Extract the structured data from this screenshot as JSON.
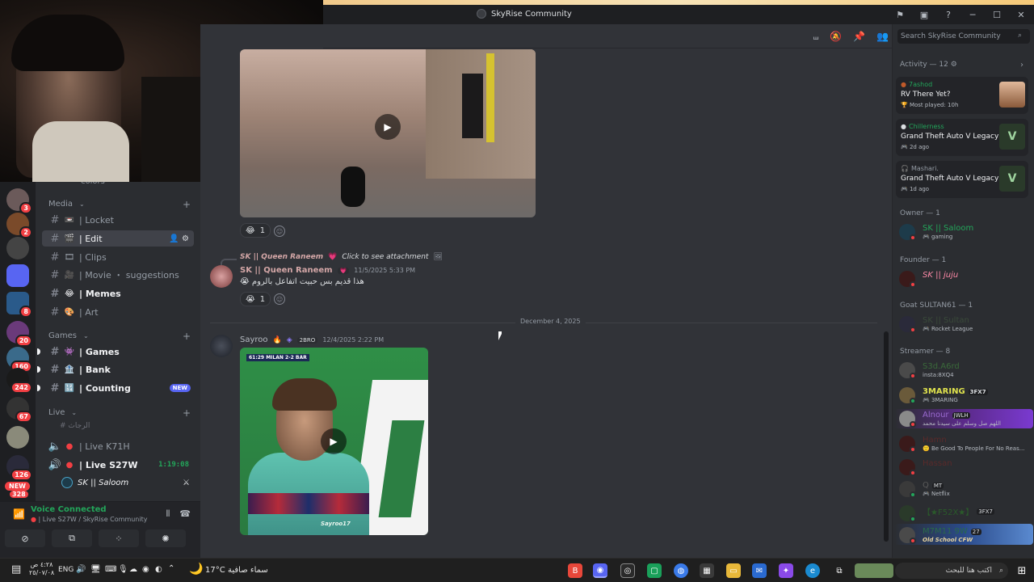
{
  "window": {
    "title": "SkyRise Community"
  },
  "header": {
    "search_placeholder": "Search SkyRise Community"
  },
  "rail": {
    "badges": [
      "3",
      "2",
      "8",
      "20",
      "160",
      "242",
      "67",
      "126",
      "328"
    ],
    "new_label": "NEW"
  },
  "channels": {
    "partial_label": "colors",
    "media_category": "Media",
    "games_category": "Games",
    "live_category": "Live",
    "live_sub": "الرجاث",
    "items": [
      {
        "label": "| Locket",
        "emoji": "📼"
      },
      {
        "label": "| Edit",
        "emoji": "🎬"
      },
      {
        "label": "| Clips",
        "emoji": "🎞"
      },
      {
        "label": "| Movie ・ suggestions",
        "emoji": "🎥"
      },
      {
        "label": "| Memes",
        "emoji": "😂"
      },
      {
        "label": "| Art",
        "emoji": "🎨"
      },
      {
        "label": "| Games",
        "emoji": "👾"
      },
      {
        "label": "| Bank",
        "emoji": "🏦"
      },
      {
        "label": "| Counting",
        "emoji": "🔢",
        "badge": "NEW"
      },
      {
        "label": "| Live K71H"
      },
      {
        "label": "| Live S27W",
        "timer": "1:19:08"
      }
    ],
    "voice_user": "SK || Saloom"
  },
  "voice": {
    "status": "Voice Connected",
    "channel": "| Live S27W / SkyRise Community"
  },
  "messages": [
    {
      "reaction_count": "1"
    },
    {
      "reply_name": "SK || Queen Raneem",
      "reply_text": "Click to see attachment",
      "author": "SK || Queen Raneem",
      "time": "11/5/2025 5:33 PM",
      "text": "هذا قديم بس حبيت اتفاعل بالروم",
      "reaction_count": "1"
    },
    {
      "author": "Sayroo",
      "tag": "2BRO",
      "time": "12/4/2025 2:22 PM",
      "video_score": "61:29 MILAN 2-2 BAR",
      "video_watermark": "Sayroo17"
    }
  ],
  "divider_date": "December 4, 2025",
  "activity": {
    "heading": "Activity — 12",
    "cards": [
      {
        "user": "7ashod",
        "game": "RV There Yet?",
        "meta": "Most played: 10h"
      },
      {
        "user": "Chillerness",
        "game": "Grand Theft Auto V Legacy",
        "meta": "2d ago"
      },
      {
        "user": "Mashari.",
        "game": "Grand Theft Auto V Legacy",
        "meta": "1d ago"
      }
    ]
  },
  "members": {
    "owner_head": "Owner — 1",
    "owner": {
      "name": "SK || Saloom",
      "sub": "gaming"
    },
    "founder_head": "Founder — 1",
    "founder": {
      "name": "SK || juju"
    },
    "goat_head": "Goat SULTAN61 — 1",
    "goat": {
      "name": "SK || Sultan",
      "sub": "Rocket League"
    },
    "streamer_head": "Streamer — 8",
    "streamers": [
      {
        "name": "S3d.A6rd",
        "sub": "insta:8XQ4"
      },
      {
        "name": "3MARING",
        "tag": "3FX7",
        "sub": "3MARING"
      },
      {
        "name": "Alnour",
        "tag": "JWLH",
        "sub": "اللهم صل وسلم على سيدنا محمد"
      },
      {
        "name": "Hamn",
        "sub": "Be Good To People For No Reas..."
      },
      {
        "name": "Hassan"
      },
      {
        "name": "Q",
        "tag": "MT",
        "sub": "Netflix"
      },
      {
        "name": "【★F52X★】",
        "tag": "3FX7"
      },
      {
        "name": "M7M11 9W",
        "tag": "27",
        "sub": "Old School CFW"
      }
    ]
  },
  "taskbar": {
    "time": "٤:٢٨ ص",
    "date": "٢٥/٠٧/٠٨",
    "lang": "ENG",
    "weather": "17°C",
    "weather_text": "سماء صافية",
    "search_text": "اكتب هنا للبحث"
  },
  "colors": {
    "accent": "#5865f2",
    "online": "#23a55a",
    "dnd": "#f23f43",
    "owner_name": "#e0e34d",
    "queen_name": "#d4a7a7"
  }
}
